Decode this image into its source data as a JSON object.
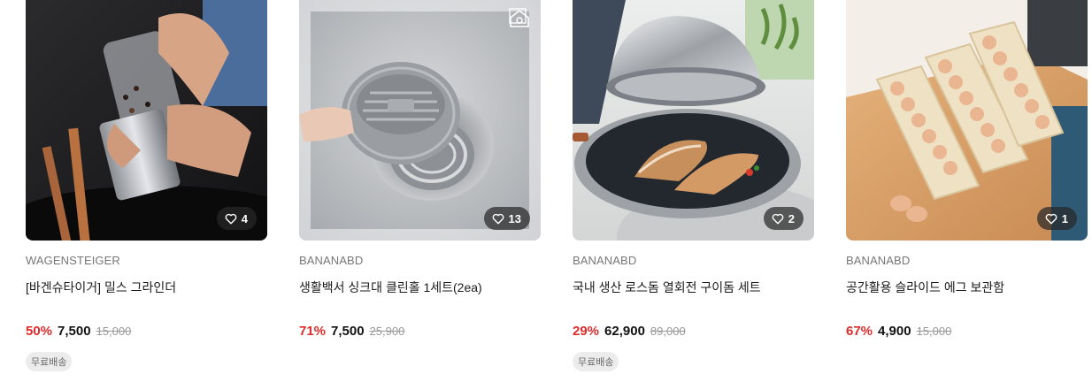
{
  "products": [
    {
      "brand": "WAGENSTEIGER",
      "title": "[바겐슈타이거] 밀스 그라인더",
      "likes": "4",
      "discount": "50%",
      "price": "7,500",
      "original_price": "15,000",
      "badge": "무료배송",
      "image": "pepper-grinder-photo"
    },
    {
      "brand": "BANANABD",
      "title": "생활백서 싱크대 클린홀 1세트(2ea)",
      "likes": "13",
      "discount": "71%",
      "price": "7,500",
      "original_price": "25,900",
      "badge": "",
      "image": "sink-drain-strainer-photo"
    },
    {
      "brand": "BANANABD",
      "title": "국내 생산 로스돔 열회전 구이돔 세트",
      "likes": "2",
      "discount": "29%",
      "price": "62,900",
      "original_price": "89,000",
      "badge": "무료배송",
      "image": "grill-pan-dome-photo"
    },
    {
      "brand": "BANANABD",
      "title": "공간활용 슬라이드 에그 보관함",
      "likes": "1",
      "discount": "67%",
      "price": "4,900",
      "original_price": "15,000",
      "badge": "",
      "image": "egg-storage-rack-photo"
    }
  ],
  "colors": {
    "discount": "#e02a2a",
    "brand_text": "#777777",
    "badge_bg": "#ececec",
    "like_pill_bg": "#282828"
  },
  "icons": {
    "like": "heart-outline-icon",
    "corner": "brand-logo-icon"
  }
}
